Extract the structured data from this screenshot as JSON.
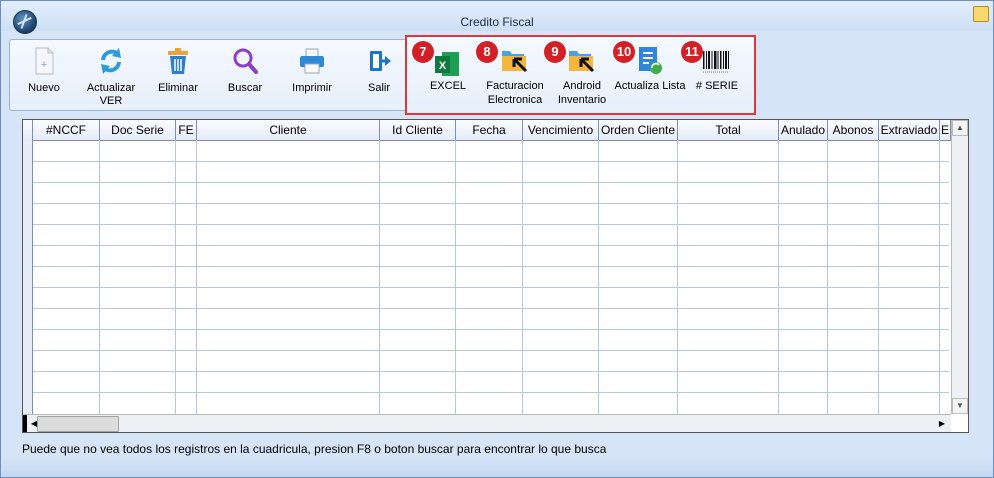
{
  "window": {
    "title": "Credito Fiscal"
  },
  "toolbar": {
    "buttons": [
      {
        "label": "Nuevo",
        "icon": "new-document-icon"
      },
      {
        "label": "Actualizar VER",
        "icon": "refresh-icon"
      },
      {
        "label": "Eliminar",
        "icon": "trash-icon"
      },
      {
        "label": "Buscar",
        "icon": "search-icon"
      },
      {
        "label": "Imprimir",
        "icon": "printer-icon"
      },
      {
        "label": "Salir",
        "icon": "exit-icon"
      }
    ]
  },
  "highlight": {
    "buttons": [
      {
        "badge": "7",
        "label": "EXCEL",
        "icon": "excel-icon"
      },
      {
        "badge": "8",
        "label": "Facturacion Electronica",
        "icon": "folder-arrow-icon"
      },
      {
        "badge": "9",
        "label": "Android Inventario",
        "icon": "folder-arrow-icon"
      },
      {
        "badge": "10",
        "label": "Actualiza Lista",
        "icon": "list-refresh-icon"
      },
      {
        "badge": "11",
        "label": "# SERIE",
        "icon": "barcode-icon"
      }
    ]
  },
  "grid": {
    "columns": [
      "#NCCF",
      "Doc Serie",
      "FE",
      "Cliente",
      "Id Cliente",
      "Fecha",
      "Vencimiento",
      "Orden Cliente",
      "Total",
      "Anulado",
      "Abonos",
      "Extraviado",
      "E"
    ]
  },
  "status": {
    "message": "Puede que no vea todos los registros en la cuadricula, presion F8 o boton buscar para encontrar lo que busca"
  },
  "colors": {
    "accent": "#e0363b",
    "badge": "#d32027",
    "frame": "#d6e4f7"
  }
}
